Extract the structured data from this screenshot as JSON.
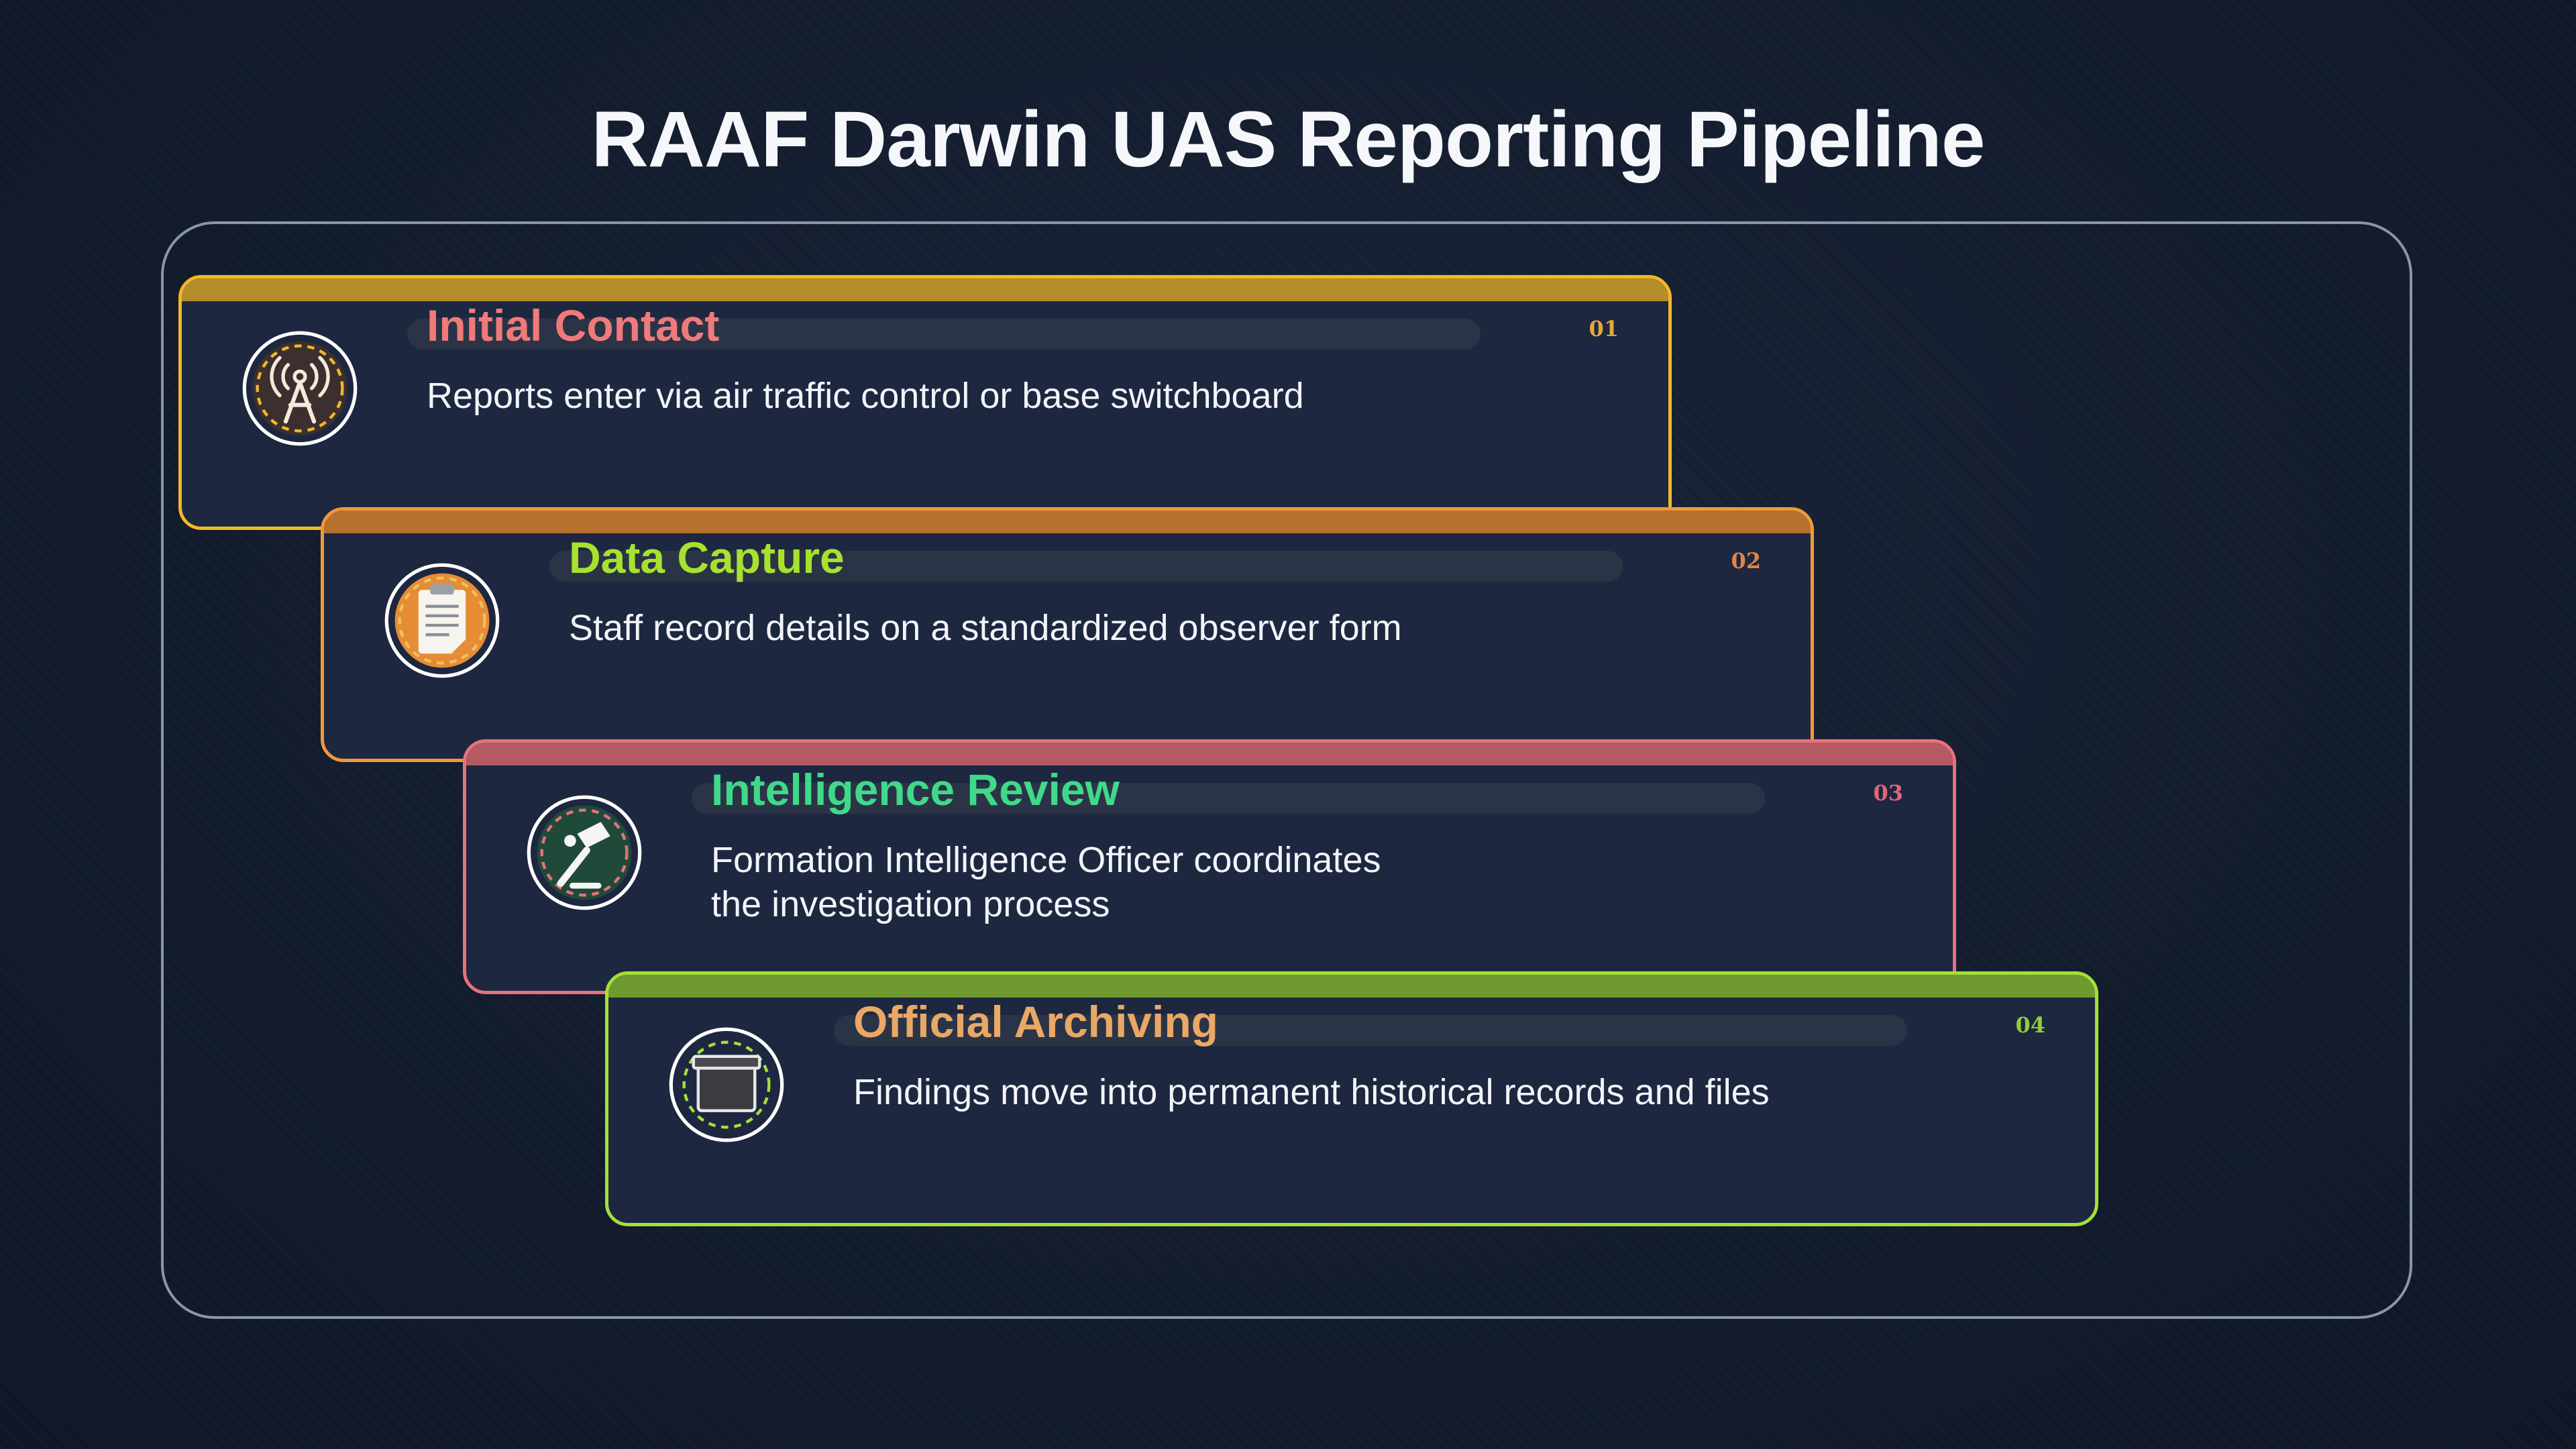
{
  "title": "RAAF Darwin UAS Reporting Pipeline",
  "steps": [
    {
      "number": "01",
      "title": "Initial Contact",
      "description": "Reports enter via air traffic control or base switchboard",
      "icon": "radio-tower-icon",
      "border_color": "#f2b826",
      "bar_color": "#b48c2a",
      "title_color": "#f07a7a",
      "number_color": "#e0a93a"
    },
    {
      "number": "02",
      "title": "Data Capture",
      "description": "Staff record details on a standardized observer form",
      "icon": "clipboard-icon",
      "border_color": "#f0993a",
      "bar_color": "#b8702e",
      "title_color": "#a6e22e",
      "number_color": "#e0844a"
    },
    {
      "number": "03",
      "title": "Intelligence Review",
      "description": "Formation Intelligence Officer coordinates the investigation process",
      "icon": "magnifier-icon",
      "border_color": "#e8717a",
      "bar_color": "#b45a62",
      "title_color": "#3fd98a",
      "number_color": "#e0667a"
    },
    {
      "number": "04",
      "title": "Official Archiving",
      "description": "Findings move into permanent historical records and files",
      "icon": "archive-box-icon",
      "border_color": "#a4e03a",
      "bar_color": "#6e9a30",
      "title_color": "#e9a866",
      "number_color": "#93cc3a"
    }
  ]
}
